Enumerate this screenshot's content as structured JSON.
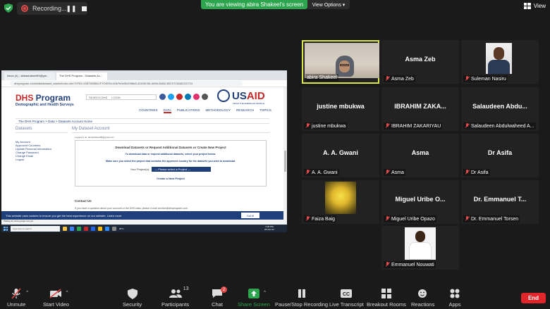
{
  "recording": {
    "label": "Recording..."
  },
  "banner": {
    "viewing": "You are viewing abira Shakeel's screen",
    "view_options": "View Options ▾"
  },
  "view": {
    "label": "View"
  },
  "shared_screen": {
    "tabs": [
      "Inbox (4) - abirashakeel99@gm...",
      "The DHS Program - Datasets Ac..."
    ],
    "url": "dhsprogram.com/data/dataset_admin/index.cfm?CFID=15573635&CFTOKEN=40b7b0e0b2098e8-42400C56-A694-B488-3BC07C8A81CD724",
    "logo_title_a": "DHS",
    "logo_title_b": " Program",
    "logo_sub": "Demographic and Health Surveys",
    "search_placeholder": "SEARCH DHS",
    "login": "LOGIN",
    "usaid_a": "US",
    "usaid_b": "AID",
    "usaid_sub": "FROM THE AMERICAN PEOPLE",
    "nav": [
      "COUNTRIES",
      "DATA",
      "PUBLICATIONS",
      "METHODOLOGY",
      "RESEARCH",
      "TOPICS"
    ],
    "breadcrumb": "The DHS Program  >  Data  >  Datasets Account Home",
    "left_heading": "Datasets",
    "left_links": [
      "My Account",
      "Approved Countries",
      "Update Personal Information",
      "Change Password",
      "Change Email",
      "Logout"
    ],
    "right_heading": "My Dataset Account",
    "logged_as": "Logged in as: abirashakeel99@gmail.com",
    "form_title": "Download Datasets or Request Additional Datasets or Create New Project",
    "form_inst_1": "To download data or request additional datasets, select your project below.",
    "form_inst_2": "Make sure you select the project that contains the approved country for the datasets you wish to download.",
    "project_label": "Your Project(s):",
    "project_select": "--- Please select a Project ---",
    "create_project": "Create a New Project",
    "contact_heading": "Contact Us",
    "contact_text": "If you have a question about your account or the DHS data, please e-mail archive@dhsprogram.com",
    "cookie_text": "This website uses cookies to ensure you get the best experience on our website.  Learn more",
    "got_it": "Got it!",
    "status": "Waiting for www.google.com.pk...",
    "taskbar_search": "Type here to search",
    "clock_time": "2:36 PM",
    "clock_date": "26-Nov-21",
    "weather": "28°C"
  },
  "participants": [
    {
      "display": "",
      "label": "abira Shakeel"
    },
    {
      "display": "Asma Zeb",
      "label": "Asma Zeb"
    },
    {
      "display": "",
      "label": "Suleman Nasiru"
    },
    {
      "display": "justine mbukwa",
      "label": "justine mbukwa"
    },
    {
      "display": "IBRAHIM ZAKA...",
      "label": "IBRAHIM ZAKARIYAU"
    },
    {
      "display": "Salaudeen  Abdu...",
      "label": "Salaudeen Abdulwaheed A..."
    },
    {
      "display": "A. A. Gwani",
      "label": "A. A. Gwani"
    },
    {
      "display": "Asma",
      "label": "Asma"
    },
    {
      "display": "Dr Asifa",
      "label": "Dr Asifa"
    },
    {
      "display": "",
      "label": "Faiza Baig"
    },
    {
      "display": "Miguel Uribe O...",
      "label": "Miguel Uribe Opazo"
    },
    {
      "display": "Dr. Emmanuel T...",
      "label": "Dr. Emmanuel Torsen"
    },
    {
      "display": "",
      "label": "Emmanuel Nouwati"
    }
  ],
  "toolbar": {
    "unmute": "Unmute",
    "start_video": "Start Video",
    "security": "Security",
    "participants": "Participants",
    "participants_count": "13",
    "chat": "Chat",
    "chat_badge": "2",
    "share_screen": "Share Screen",
    "pause_recording": "Pause/Stop Recording",
    "live_transcript": "Live Transcript",
    "breakout_rooms": "Breakout Rooms",
    "reactions": "Reactions",
    "apps": "Apps",
    "end": "End"
  },
  "colors": {
    "green": "#2da44e",
    "end_red": "#e0262a",
    "speaking": "#dce84a",
    "muted": "#e24a4a"
  }
}
